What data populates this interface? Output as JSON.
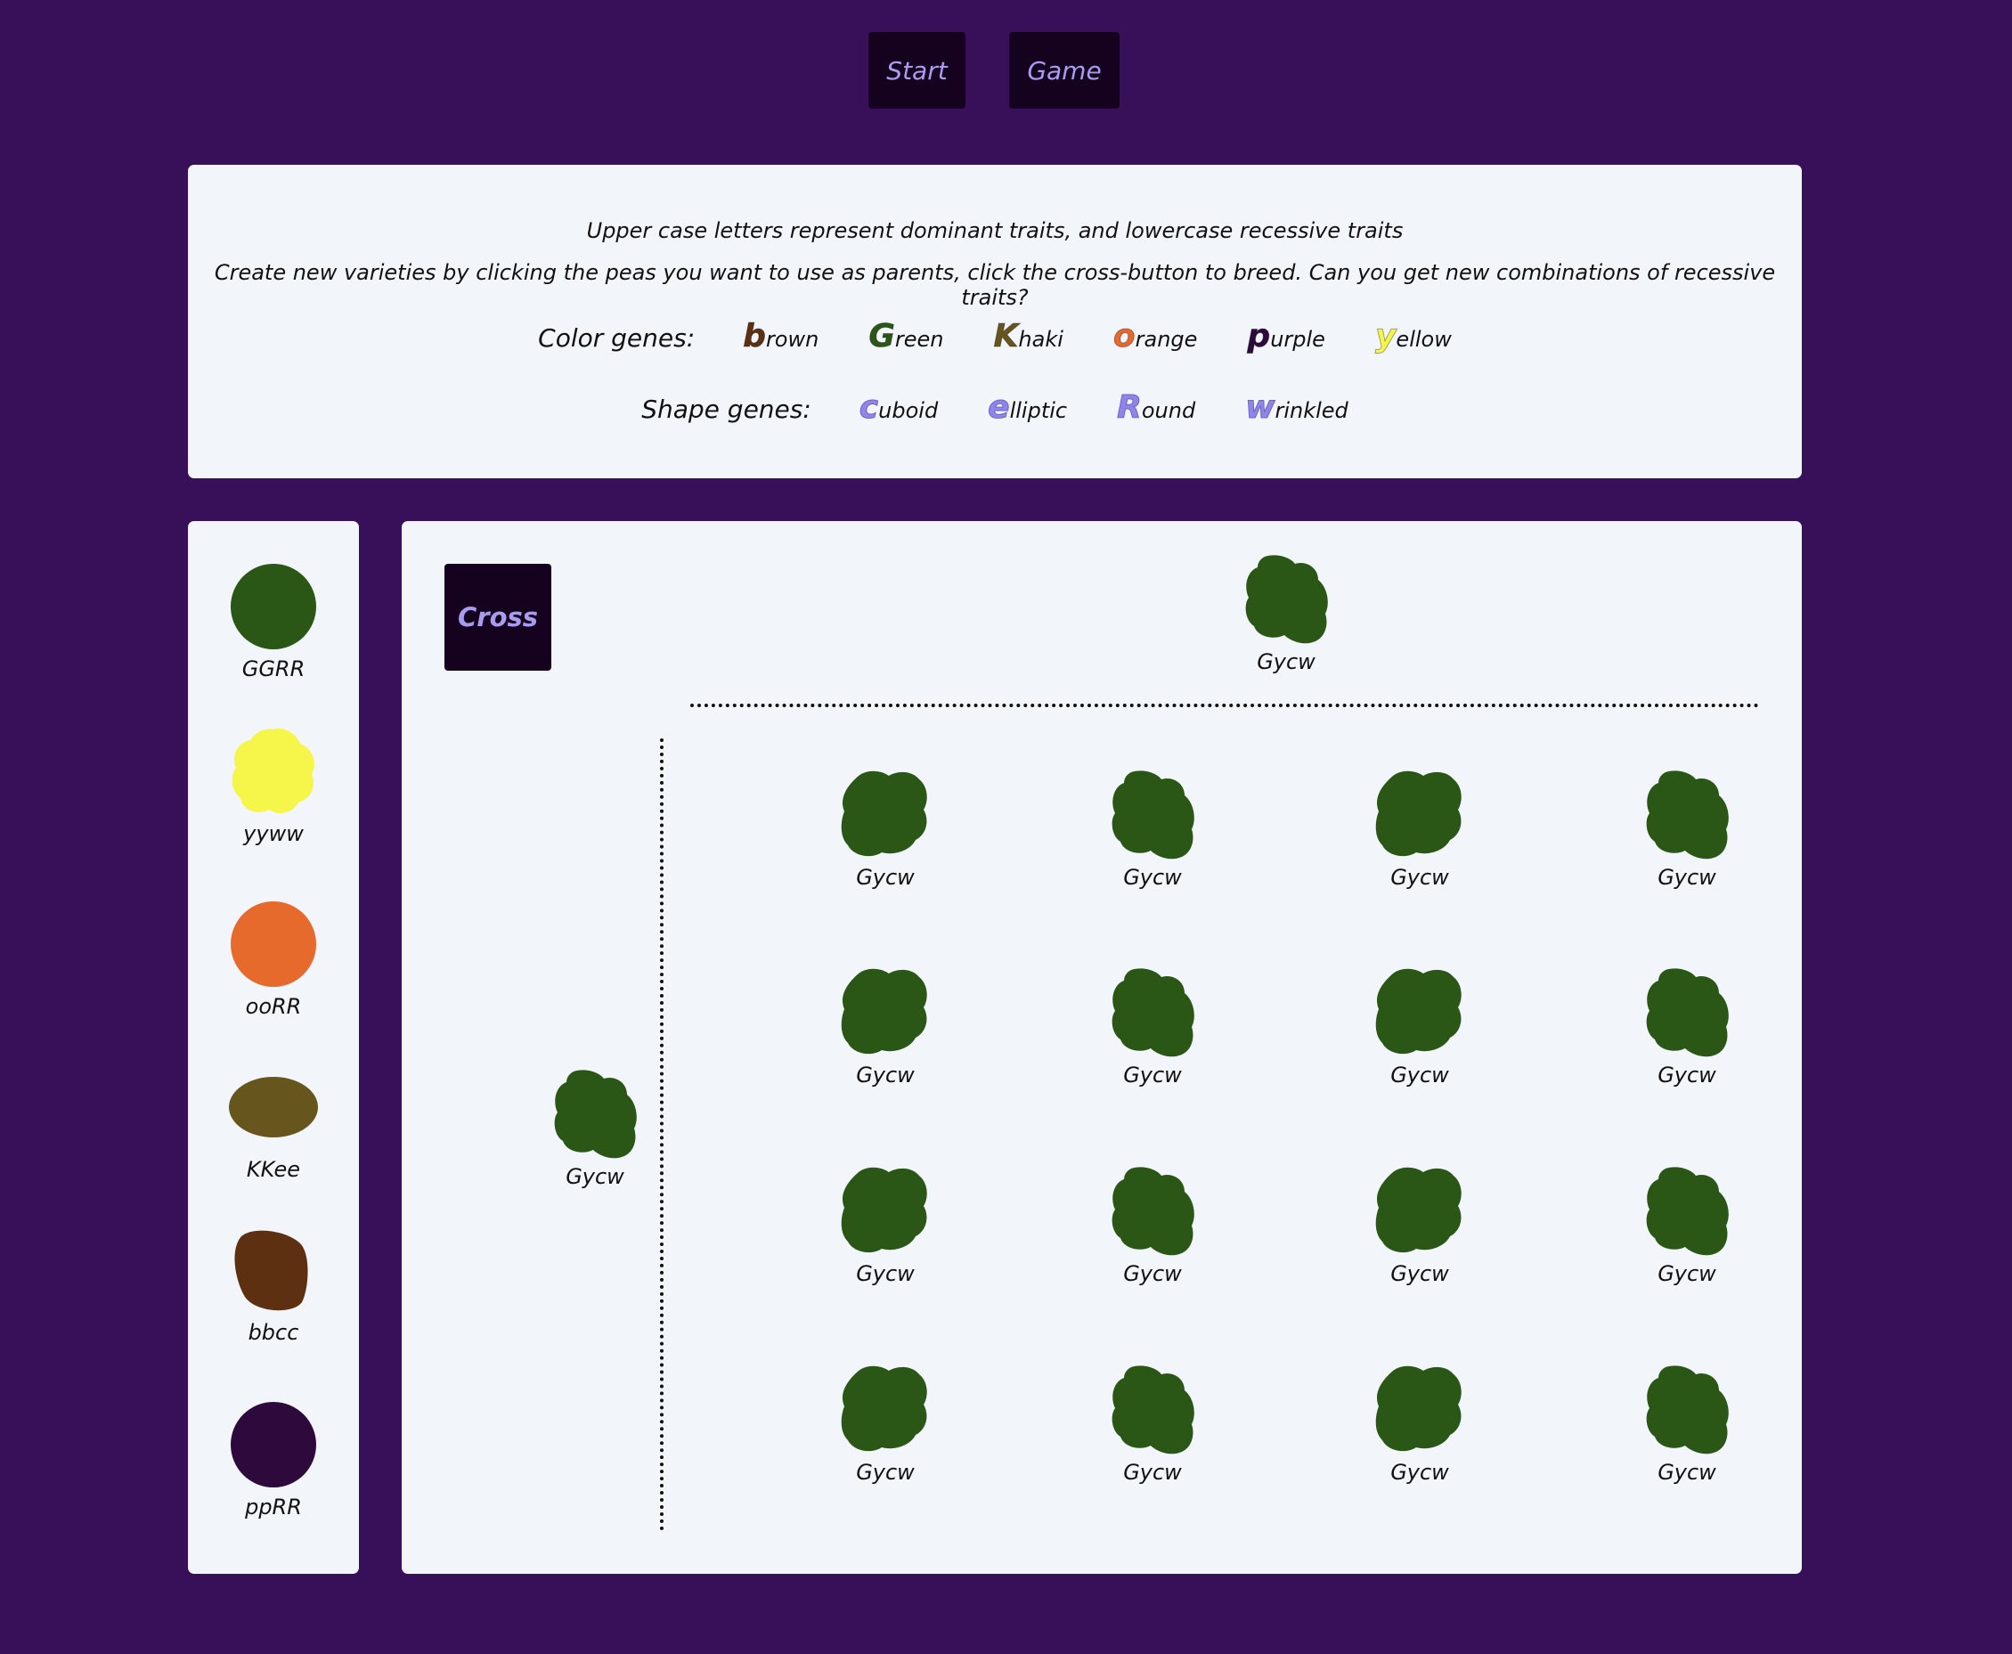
{
  "nav": {
    "start_label": "Start",
    "game_label": "Game"
  },
  "info": {
    "line1": "Upper case letters represent dominant traits, and lowercase recessive traits",
    "line2": "Create new varieties by clicking the peas you want to use as parents, click the cross-button to breed. Can you get new combinations of recessive traits?",
    "color_title": "Color genes:",
    "shape_title": "Shape genes:",
    "color_genes": [
      {
        "letter": "b",
        "rest": "rown",
        "color": "#5c3010"
      },
      {
        "letter": "G",
        "rest": "reen",
        "color": "#2b5716"
      },
      {
        "letter": "K",
        "rest": "haki",
        "color": "#66561e"
      },
      {
        "letter": "o",
        "rest": "range",
        "color": "#e56a2b"
      },
      {
        "letter": "p",
        "rest": "urple",
        "color": "#2e0a3c"
      },
      {
        "letter": "y",
        "rest": "ellow",
        "color": "#f6f64a"
      }
    ],
    "shape_genes": [
      {
        "letter": "c",
        "rest": "uboid"
      },
      {
        "letter": "e",
        "rest": "lliptic"
      },
      {
        "letter": "R",
        "rest": "ound"
      },
      {
        "letter": "w",
        "rest": "rinkled"
      }
    ]
  },
  "stock": [
    {
      "genotype": "GGRR",
      "color": "#2b5716",
      "shape": "round"
    },
    {
      "genotype": "yyww",
      "color": "#f6f64a",
      "shape": "wrinkled"
    },
    {
      "genotype": "ooRR",
      "color": "#e56a2b",
      "shape": "round"
    },
    {
      "genotype": "KKee",
      "color": "#66561e",
      "shape": "elliptic"
    },
    {
      "genotype": "bbcc",
      "color": "#5c3010",
      "shape": "cuboid"
    },
    {
      "genotype": "ppRR",
      "color": "#2e0a3c",
      "shape": "round"
    }
  ],
  "cross": {
    "button_label": "Cross",
    "parent_top": {
      "genotype": "Gycw",
      "color": "#2b5716",
      "shape": "wrinkled-cuboid"
    },
    "parent_left": {
      "genotype": "Gycw",
      "color": "#2b5716",
      "shape": "wrinkled-cuboid"
    },
    "offspring": [
      {
        "genotype": "Gycw",
        "color": "#2b5716",
        "shape": "wrinkled-wide"
      },
      {
        "genotype": "Gycw",
        "color": "#2b5716",
        "shape": "wrinkled-cuboid"
      },
      {
        "genotype": "Gycw",
        "color": "#2b5716",
        "shape": "wrinkled-wide"
      },
      {
        "genotype": "Gycw",
        "color": "#2b5716",
        "shape": "wrinkled-cuboid"
      },
      {
        "genotype": "Gycw",
        "color": "#2b5716",
        "shape": "wrinkled-wide"
      },
      {
        "genotype": "Gycw",
        "color": "#2b5716",
        "shape": "wrinkled-cuboid"
      },
      {
        "genotype": "Gycw",
        "color": "#2b5716",
        "shape": "wrinkled-wide"
      },
      {
        "genotype": "Gycw",
        "color": "#2b5716",
        "shape": "wrinkled-cuboid"
      },
      {
        "genotype": "Gycw",
        "color": "#2b5716",
        "shape": "wrinkled-wide"
      },
      {
        "genotype": "Gycw",
        "color": "#2b5716",
        "shape": "wrinkled-cuboid"
      },
      {
        "genotype": "Gycw",
        "color": "#2b5716",
        "shape": "wrinkled-wide"
      },
      {
        "genotype": "Gycw",
        "color": "#2b5716",
        "shape": "wrinkled-cuboid"
      },
      {
        "genotype": "Gycw",
        "color": "#2b5716",
        "shape": "wrinkled-wide"
      },
      {
        "genotype": "Gycw",
        "color": "#2b5716",
        "shape": "wrinkled-cuboid"
      },
      {
        "genotype": "Gycw",
        "color": "#2b5716",
        "shape": "wrinkled-wide"
      },
      {
        "genotype": "Gycw",
        "color": "#2b5716",
        "shape": "wrinkled-cuboid"
      }
    ]
  }
}
